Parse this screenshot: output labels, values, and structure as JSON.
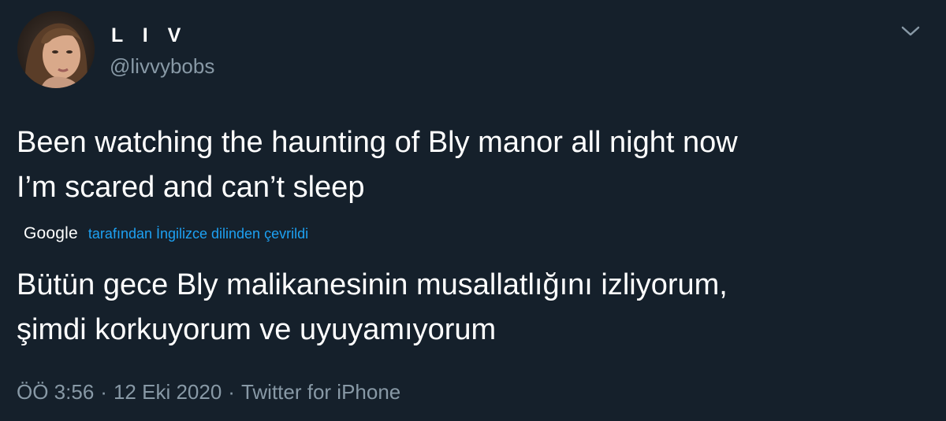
{
  "author": {
    "display_name": "L I V",
    "handle": "@livvybobs",
    "avatar": "profile-photo"
  },
  "menu": {
    "icon": "chevron-down-icon"
  },
  "tweet": {
    "text_original": "Been watching the haunting of Bly manor all night now\nI’m scared and can’t sleep",
    "translation": {
      "provider": "Google",
      "label": "tarafından İngilizce dilinden çevrildi",
      "text": "Bütün gece Bly malikanesinin musallatlığını izliyorum,\nşimdi korkuyorum ve uyuyamıyorum"
    },
    "time": "ÖÖ 3:56",
    "date": "12 Eki 2020",
    "source": "Twitter for iPhone",
    "separator": "·"
  },
  "colors": {
    "background": "#15202b",
    "text": "#ffffff",
    "secondary": "#8899a6",
    "link": "#1da1f2"
  }
}
